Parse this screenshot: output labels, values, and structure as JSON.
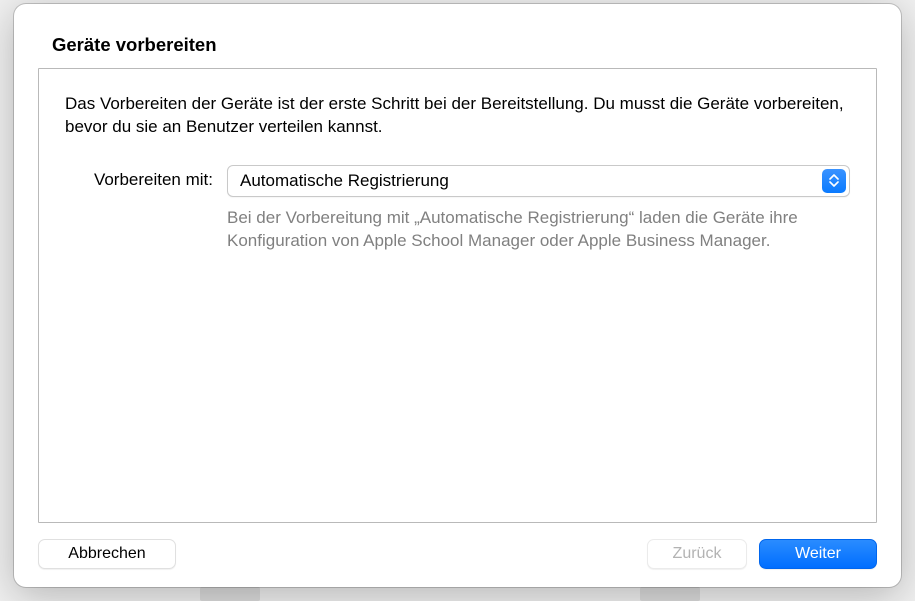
{
  "sheet": {
    "title": "Geräte vorbereiten",
    "intro": "Das Vorbereiten der Geräte ist der erste Schritt bei der Bereitstellung. Du musst die Geräte vorbereiten, bevor du sie an Benutzer verteilen kannst.",
    "prepare": {
      "label": "Vorbereiten mit:",
      "selected": "Automatische Registrierung",
      "help": "Bei der Vorbereitung mit „Automatische Registrierung“ laden die Geräte ihre Konfiguration von Apple School Manager oder Apple Business Manager."
    }
  },
  "buttons": {
    "cancel": "Abbrechen",
    "back": "Zurück",
    "next": "Weiter"
  },
  "colors": {
    "accent": "#0a7bff",
    "border": "#b9b9b9",
    "helpText": "#808080"
  }
}
